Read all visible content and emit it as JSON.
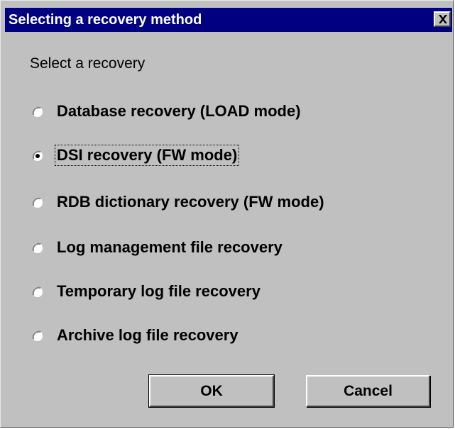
{
  "window": {
    "title": "Selecting a recovery method",
    "close_icon": "close-x-icon"
  },
  "heading": "Select a recovery",
  "options": [
    {
      "label": "Database recovery (LOAD mode)",
      "checked": false
    },
    {
      "label": "DSI recovery (FW mode)",
      "checked": true,
      "focused": true
    },
    {
      "label": "RDB dictionary recovery (FW mode)",
      "checked": false
    },
    {
      "label": "Log management file recovery",
      "checked": false
    },
    {
      "label": "Temporary log file recovery",
      "checked": false
    },
    {
      "label": "Archive log file recovery",
      "checked": false
    }
  ],
  "buttons": {
    "ok_label": "OK",
    "cancel_label": "Cancel"
  },
  "colors": {
    "titlebar": "#000080",
    "face": "#c0c0c0"
  }
}
